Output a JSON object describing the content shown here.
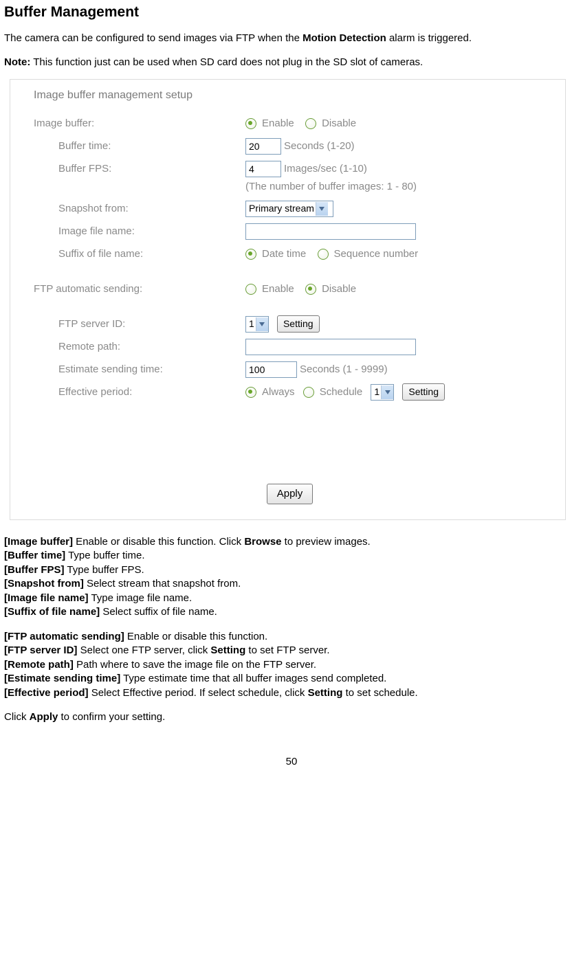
{
  "title": "Buffer Management",
  "intro_pre": "The camera can be configured to send images via FTP when the ",
  "intro_bold": "Motion Detection",
  "intro_post": " alarm is triggered.",
  "note_label": "Note:",
  "note_text": " This function just can be used when SD card does not plug in the SD slot of cameras.",
  "panel": {
    "title": "Image buffer management setup",
    "labels": {
      "image_buffer": "Image buffer:",
      "buffer_time": "Buffer time:",
      "buffer_fps": "Buffer FPS:",
      "snapshot_from": "Snapshot from:",
      "image_file_name": "Image file name:",
      "suffix": "Suffix of file name:",
      "ftp_auto": "FTP automatic sending:",
      "ftp_server_id": "FTP server ID:",
      "remote_path": "Remote path:",
      "est_time": "Estimate sending time:",
      "eff_period": "Effective period:"
    },
    "opts": {
      "enable": "Enable",
      "disable": "Disable",
      "datetime": "Date time",
      "seqnum": "Sequence number",
      "always": "Always",
      "schedule": "Schedule"
    },
    "values": {
      "buffer_time": "20",
      "buffer_fps": "4",
      "snapshot_from": "Primary stream",
      "ftp_server_id": "1",
      "est_time": "100",
      "schedule_id": "1",
      "image_file_name": "",
      "remote_path": ""
    },
    "units": {
      "buffer_time": "Seconds (1-20)",
      "buffer_fps": "Images/sec (1-10)",
      "buffer_note": "(The number of buffer images: 1 - 80)",
      "est_time": "Seconds (1 - 9999)"
    },
    "buttons": {
      "setting": "Setting",
      "apply": "Apply"
    }
  },
  "defs": {
    "image_buffer": {
      "k": "[Image buffer]",
      "pre": " Enable or disable this function. Click ",
      "b": "Browse",
      "post": " to preview images."
    },
    "buffer_time": {
      "k": "[Buffer time]",
      "t": " Type buffer time."
    },
    "buffer_fps": {
      "k": "[Buffer FPS]",
      "t": " Type buffer FPS."
    },
    "snapshot_from": {
      "k": "[Snapshot from]",
      "t": " Select stream that snapshot from."
    },
    "image_file_name": {
      "k": "[Image file name]",
      "t": " Type image file name."
    },
    "suffix": {
      "k": "[Suffix of file name]",
      "t": " Select suffix of file name."
    },
    "ftp_auto": {
      "k": "[FTP automatic sending]",
      "t": " Enable or disable this function."
    },
    "ftp_server_id": {
      "k": "[FTP server ID]",
      "pre": " Select one FTP server, click ",
      "b": "Setting",
      "post": " to set FTP server."
    },
    "remote_path": {
      "k": "[Remote path]",
      "t": " Path where to save the image file on the FTP server."
    },
    "est_time": {
      "k": "[Estimate sending time]",
      "t": " Type estimate time that all buffer images send completed."
    },
    "eff_period": {
      "k": "[Effective period]",
      "pre": " Select Effective period. If select schedule, click ",
      "b": "Setting",
      "post": " to set schedule."
    }
  },
  "outro_pre": "Click ",
  "outro_bold": "Apply",
  "outro_post": " to confirm your setting.",
  "page_number": "50"
}
